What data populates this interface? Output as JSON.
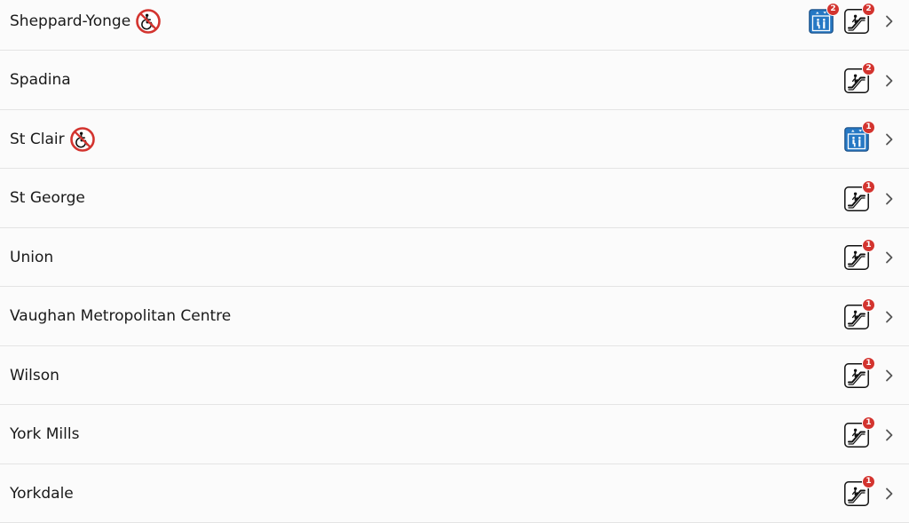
{
  "colors": {
    "background": "#fbfbfb",
    "divider": "#e4e4e4",
    "badge": "#d3342f",
    "elevator": "#2678c4",
    "no_access_ring": "#d3342f"
  },
  "stations": [
    {
      "name": "Sheppard-Yonge",
      "not_accessible": true,
      "elevator_outages": "2",
      "escalator_outages": "2"
    },
    {
      "name": "Spadina",
      "not_accessible": false,
      "elevator_outages": null,
      "escalator_outages": "2"
    },
    {
      "name": "St Clair",
      "not_accessible": true,
      "elevator_outages": "1",
      "escalator_outages": null
    },
    {
      "name": "St George",
      "not_accessible": false,
      "elevator_outages": null,
      "escalator_outages": "1"
    },
    {
      "name": "Union",
      "not_accessible": false,
      "elevator_outages": null,
      "escalator_outages": "1"
    },
    {
      "name": "Vaughan Metropolitan Centre",
      "not_accessible": false,
      "elevator_outages": null,
      "escalator_outages": "1"
    },
    {
      "name": "Wilson",
      "not_accessible": false,
      "elevator_outages": null,
      "escalator_outages": "1"
    },
    {
      "name": "York Mills",
      "not_accessible": false,
      "elevator_outages": null,
      "escalator_outages": "1"
    },
    {
      "name": "Yorkdale",
      "not_accessible": false,
      "elevator_outages": null,
      "escalator_outages": "1"
    }
  ],
  "icons": {
    "no_access": "wheelchair-not-accessible-icon",
    "elevator": "elevator-icon",
    "escalator": "escalator-icon",
    "chevron": "chevron-right-icon"
  }
}
